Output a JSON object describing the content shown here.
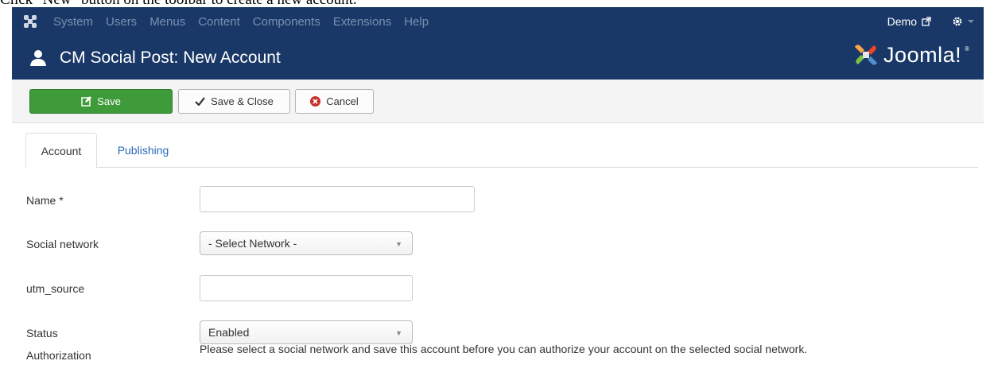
{
  "caption": "Click \"New\" button on the toolbar to create a new account.",
  "topnav": {
    "menu": [
      "System",
      "Users",
      "Menus",
      "Content",
      "Components",
      "Extensions",
      "Help"
    ],
    "demo_label": "Demo"
  },
  "header": {
    "title": "CM Social Post: New Account",
    "logo_text": "Joomla!",
    "logo_tm": "®"
  },
  "toolbar": {
    "save_label": "Save",
    "save_close_label": "Save & Close",
    "cancel_label": "Cancel"
  },
  "tabs": {
    "account": "Account",
    "publishing": "Publishing"
  },
  "form": {
    "name_label": "Name *",
    "name_value": "",
    "social_network_label": "Social network",
    "social_network_value": "- Select Network -",
    "utm_source_label": "utm_source",
    "utm_source_value": "",
    "status_label": "Status",
    "status_value": "Enabled",
    "authorization_label": "Authorization",
    "authorization_text": "Please select a social network and save this account before you can authorize your account on the selected social network."
  },
  "colors": {
    "nav_bg": "#1a3867",
    "save_green": "#3f9b3a",
    "link_blue": "#2a69b8"
  }
}
